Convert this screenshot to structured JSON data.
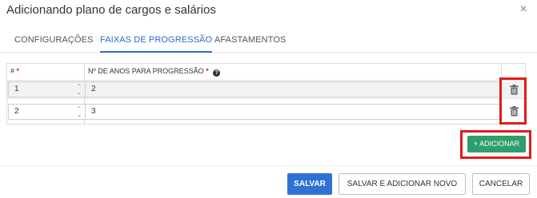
{
  "dialog": {
    "title": "Adicionando plano de cargos e salários",
    "close_glyph": "×"
  },
  "tabs": [
    {
      "label": "CONFIGURAÇÕES",
      "active": false
    },
    {
      "label": "FAIXAS DE PROGRESSÃO",
      "active": true
    },
    {
      "label": "AFASTAMENTOS",
      "active": false
    }
  ],
  "table": {
    "columns": [
      {
        "label": "#",
        "required": true,
        "required_mark": "*"
      },
      {
        "label": "Nº DE ANOS PARA PROGRESSÃO",
        "required": true,
        "required_mark": "*",
        "help_icon": "question-circle-icon",
        "help_glyph": "?"
      }
    ],
    "rows": [
      {
        "index": "1",
        "years": "2",
        "delete_icon": "trash-icon"
      },
      {
        "index": "2",
        "years": "3",
        "delete_icon": "trash-icon"
      }
    ],
    "spinner_glyphs": {
      "up": "⌃",
      "down": "⌄"
    }
  },
  "add_button": {
    "label": "ADICIONAR",
    "icon_glyph": "+",
    "color": "#2e9e6b"
  },
  "footer": {
    "save_label": "SALVAR",
    "save_add_new_label": "SALVAR E ADICIONAR NOVO",
    "cancel_label": "CANCELAR"
  },
  "colors": {
    "accent": "#2a6cc8",
    "primary_button": "#2f72d6",
    "highlight_box": "#e21b1b",
    "required": "#e02424"
  }
}
